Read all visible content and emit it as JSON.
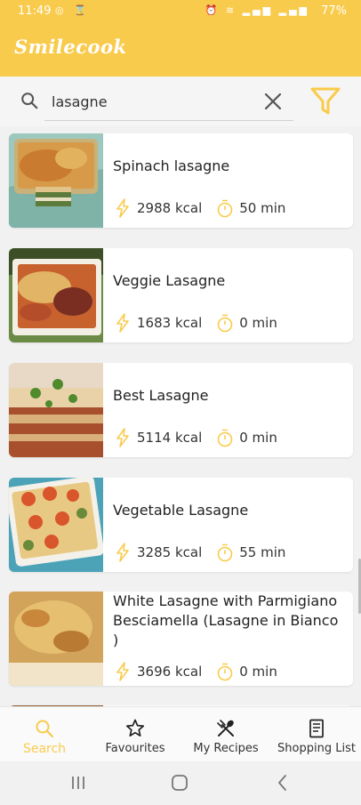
{
  "status_bar": {
    "time": "11:49",
    "battery": "77%"
  },
  "app": {
    "title": "Smilecook"
  },
  "search": {
    "query": "lasagne"
  },
  "recipes": [
    {
      "title": "Spinach lasagne",
      "kcal": "2988 kcal",
      "time": "50 min"
    },
    {
      "title": "Veggie Lasagne",
      "kcal": "1683 kcal",
      "time": "0 min"
    },
    {
      "title": "Best Lasagne",
      "kcal": "5114 kcal",
      "time": "0 min"
    },
    {
      "title": "Vegetable Lasagne",
      "kcal": "3285 kcal",
      "time": "55 min"
    },
    {
      "title": "White Lasagne with Parmigiano Besciamella (Lasagne in Bianco )",
      "kcal": "3696 kcal",
      "time": "0 min"
    }
  ],
  "bottom_nav": {
    "search": "Search",
    "favourites": "Favourites",
    "my_recipes": "My Recipes",
    "shopping_list": "Shopping List"
  },
  "colors": {
    "accent": "#f9cb4c",
    "background": "#f1f1f1"
  },
  "icons": {
    "search": "search-icon",
    "clear": "close-icon",
    "filter": "filter-icon",
    "calories": "lightning-icon",
    "time": "stopwatch-icon",
    "favourites": "star-icon",
    "my_recipes": "utensils-icon",
    "shopping_list": "receipt-icon"
  }
}
